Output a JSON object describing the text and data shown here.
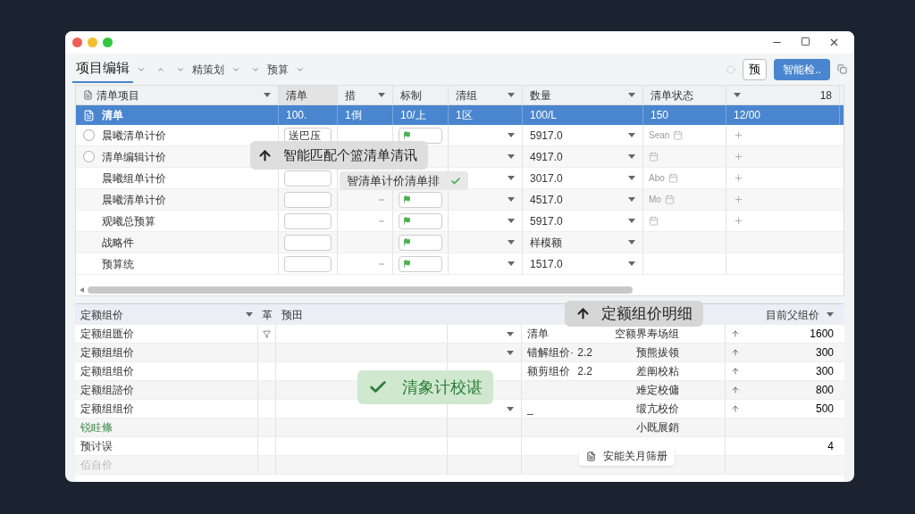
{
  "toolbar": {
    "tabs": [
      {
        "label": "项目编辑",
        "selected": true
      },
      {
        "label": "精策划",
        "selected": false
      },
      {
        "label": "预算",
        "selected": false
      }
    ],
    "preview_button": "预",
    "check_button": "智能检.."
  },
  "top_table": {
    "columns": [
      {
        "label": "清单项目",
        "menu": true
      },
      {
        "label": "清单",
        "menu": false
      },
      {
        "label": "措",
        "menu": true
      },
      {
        "label": "标制",
        "menu": false
      },
      {
        "label": "清组",
        "menu": true
      },
      {
        "label": "数量",
        "menu": true
      },
      {
        "label": "清单状态",
        "menu": false
      },
      {
        "label": "18",
        "menu": true
      }
    ],
    "rows": [
      {
        "name": "清单",
        "selected": true,
        "cells": [
          "100.",
          "1倒",
          "10/上",
          "1区",
          "100/L",
          "150",
          "12/00"
        ]
      },
      {
        "name": "晨曦清单计价",
        "selected": false,
        "kind": "check",
        "checked": false,
        "code": "送巴压",
        "dash": false,
        "flag": true,
        "amount": "5917.0",
        "status": "Sean",
        "plus": true
      },
      {
        "name": "清单编辑计价",
        "selected": false,
        "kind": "check",
        "checked": false,
        "code": "",
        "dash": false,
        "flag": false,
        "amount": "4917.0",
        "status": "",
        "plus": true
      },
      {
        "name": "晨曦组单计价",
        "selected": false,
        "kind": "plain",
        "code": "",
        "dash": false,
        "flag": false,
        "amount": "3017.0",
        "status": "Abo",
        "plus": true
      },
      {
        "name": "晨曦清单计价",
        "selected": false,
        "kind": "plain",
        "code": "",
        "dash": true,
        "flag": true,
        "amount": "4517.0",
        "status": "Mo",
        "plus": true
      },
      {
        "name": "观曦总预算",
        "selected": false,
        "kind": "plain",
        "code": "",
        "dash": true,
        "flag": true,
        "amount": "5917.0",
        "status": "",
        "plus": true
      },
      {
        "name": "战略件",
        "selected": false,
        "kind": "plain",
        "code": "",
        "dash": false,
        "flag": true,
        "amount": "样模额",
        "status": "",
        "plus": false
      },
      {
        "name": "预算统",
        "selected": false,
        "kind": "plain",
        "code": "",
        "dash": true,
        "flag": true,
        "amount": "1517.0",
        "status": "",
        "plus": false
      }
    ]
  },
  "match_tooltip": "智能匹配个篮清单清讯",
  "match_suggestion": "智清单计价清单排",
  "bottom_table": {
    "columns": [
      {
        "label": "定额组价",
        "menu": true
      },
      {
        "label": "革",
        "menu": false
      },
      {
        "label": "预田",
        "menu": false
      }
    ],
    "summary_label": "目前父组价",
    "rows": [
      {
        "name": "定额组匯价",
        "kind": "normal",
        "filter": true,
        "menu": true,
        "item": "清单",
        "qty": "",
        "detail": "空额界寿场组",
        "arrow": true,
        "value": "1600"
      },
      {
        "name": "定额组组价",
        "kind": "normal",
        "filter": false,
        "menu": true,
        "item": "错解组价·",
        "qty": "2.2",
        "detail": "预熊拔领",
        "arrow": true,
        "value": "300"
      },
      {
        "name": "定额组组价",
        "kind": "normal",
        "filter": false,
        "menu": false,
        "item": "额剪组价",
        "qty": "2.2",
        "detail": "差阐校粘",
        "arrow": true,
        "value": "300"
      },
      {
        "name": "定额组諮价",
        "kind": "normal",
        "filter": false,
        "menu": false,
        "item": "",
        "qty": "",
        "detail": "难定校傭",
        "arrow": true,
        "value": "800"
      },
      {
        "name": "定额组组价",
        "kind": "normal",
        "filter": false,
        "menu": true,
        "item": "_",
        "qty": "",
        "detail": "缎亢校价",
        "arrow": true,
        "value": "500"
      },
      {
        "name": "锐眭條",
        "kind": "highlight",
        "filter": false,
        "menu": false,
        "item": "",
        "qty": "",
        "detail": "小既展銷",
        "arrow": false,
        "value": ""
      },
      {
        "name": "预讨误",
        "kind": "normal",
        "filter": false,
        "menu": false,
        "item": "",
        "qty": "",
        "detail": "",
        "arrow": false,
        "value": "4"
      },
      {
        "name": "佰自价",
        "kind": "faded",
        "filter": false,
        "menu": false,
        "item": "",
        "qty": "",
        "detail": "",
        "arrow": false,
        "value": ""
      }
    ]
  },
  "detail_tooltip": "定额组价明细",
  "toast": "清象计校谌",
  "popup": "安能关月筛册"
}
